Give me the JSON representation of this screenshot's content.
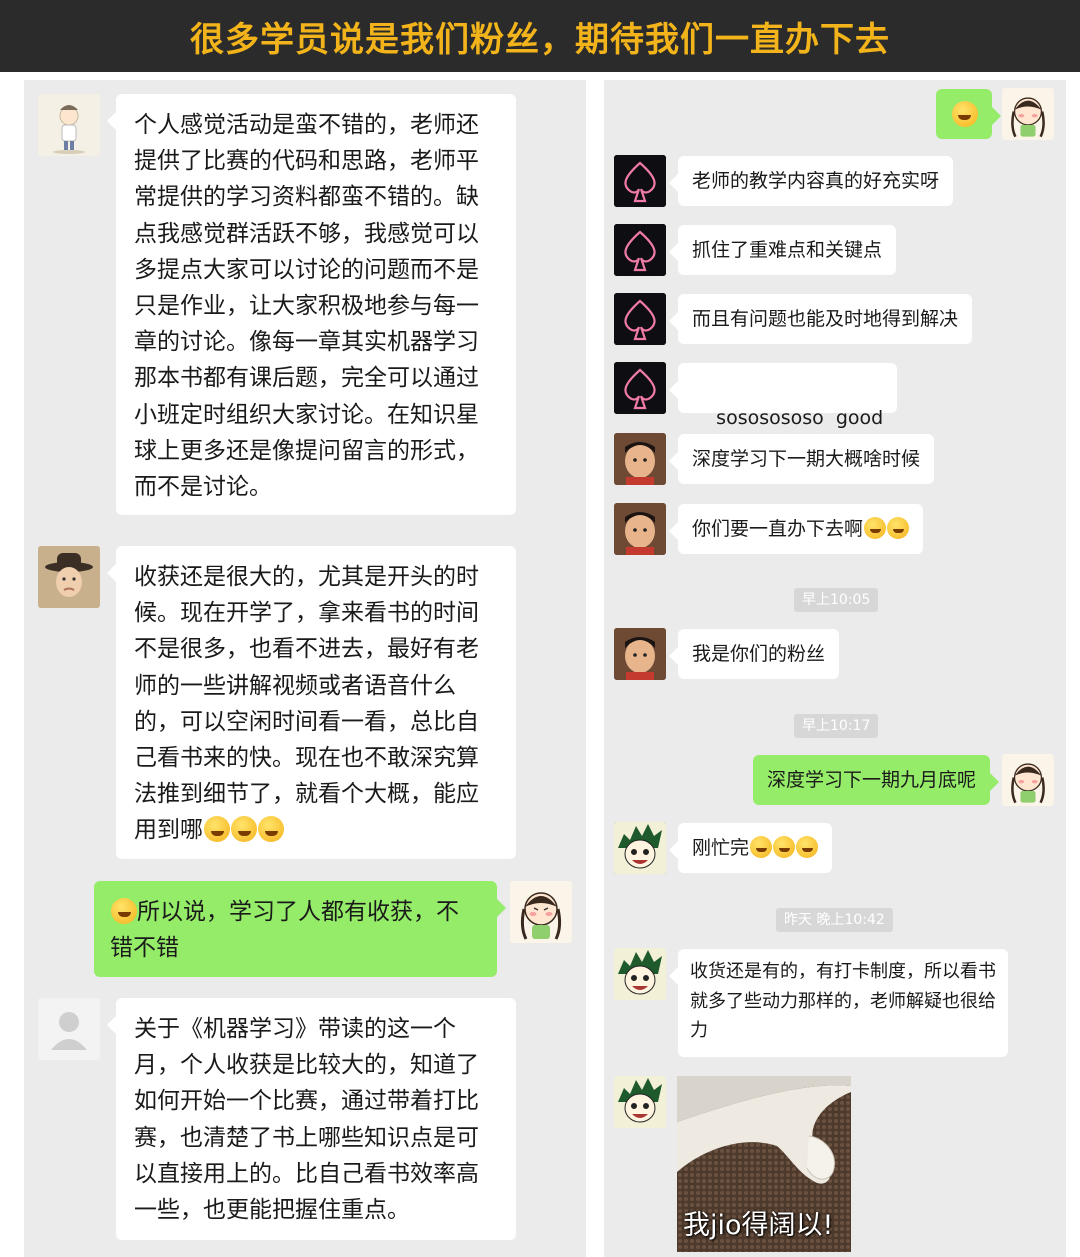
{
  "banner": {
    "title": "很多学员说是我们粉丝，期待我们一直办下去"
  },
  "left_chat": {
    "msg1": {
      "text": "个人感觉活动是蛮不错的，老师还提供了比赛的代码和思路，老师平常提供的学习资料都蛮不错的。缺点我感觉群活跃不够，我感觉可以多提点大家可以讨论的问题而不是只是作业，让大家积极地参与每一章的讨论。像每一章其实机器学习那本书都有课后题，完全可以通过小班定时组织大家讨论。在知识星球上更多还是像提问留言的形式，而不是讨论。"
    },
    "msg2": {
      "text": "收获还是很大的，尤其是开头的时候。现在开学了，拿来看书的时间不是很多，也看不进去，最好有老师的一些讲解视频或者语音什么的，可以空闲时间看一看，总比自己看书来的快。现在也不敢深究算法推到细节了，就看个大概，能应用到哪"
    },
    "msg3": {
      "text": "所以说，学习了人都有收获，不错不错"
    },
    "msg4": {
      "text": "关于《机器学习》带读的这一个月，个人收获是比较大的，知道了如何开始一个比赛，通过带着打比赛，也清楚了书上哪些知识点是可以直接用上的。比自己看书效率高一些，也更能把握住重点。"
    }
  },
  "right_chat": {
    "m1": "老师的教学内容真的好充实呀",
    "m2": "抓住了重难点和关键点",
    "m3": "而且有问题也能及时地得到解决",
    "m4": "sososososo  good",
    "m5": "深度学习下一期大概啥时候",
    "m6": "你们要一直办下去啊",
    "ts1": "早上10:05",
    "m7": "我是你们的粉丝",
    "ts2": "早上10:17",
    "m8": "深度学习下一期九月底呢",
    "m9": "刚忙完",
    "ts3": "昨天 晚上10:42",
    "m10": "收货还是有的，有打卡制度，所以看书就多了些动力那样的，老师解疑也很给力",
    "sticker_caption": "我jio得阔以!"
  },
  "colors": {
    "banner_bg": "#2b2b2b",
    "banner_text": "#f2b41a",
    "bubble_green": "#95ec69",
    "panel_bg": "#ebebeb"
  }
}
